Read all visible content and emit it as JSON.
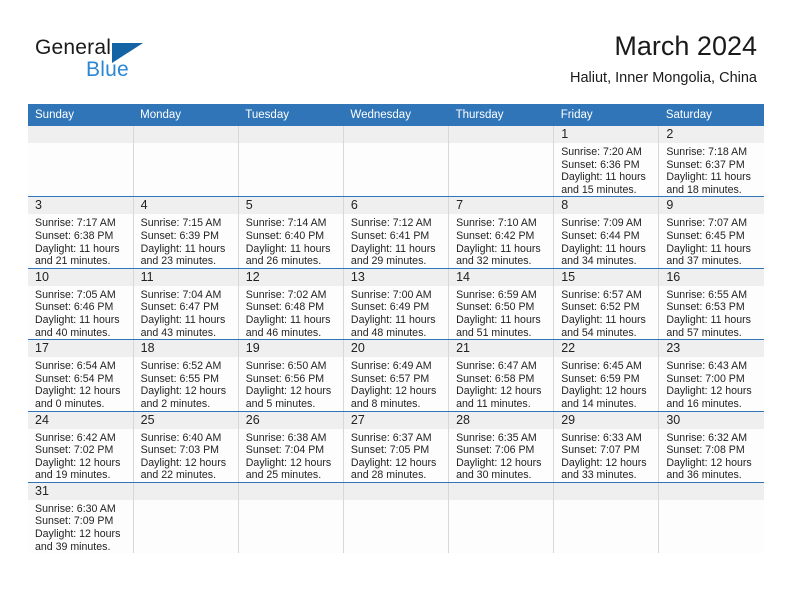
{
  "brand": {
    "name_top": "General",
    "name_bottom": "Blue",
    "triangle_color": "#1464a5",
    "blue_color": "#2b87d3"
  },
  "header": {
    "title": "March 2024",
    "subtitle": "Haliut, Inner Mongolia, China"
  },
  "theme": {
    "header_blue": "#3075b8",
    "day_band_gray": "#efefef",
    "cell_bg": "#fdfdfd",
    "row_divider": "#3075b8",
    "col_divider": "#d8d8d8"
  },
  "weekdays": [
    "Sunday",
    "Monday",
    "Tuesday",
    "Wednesday",
    "Thursday",
    "Friday",
    "Saturday"
  ],
  "weeks": [
    [
      {
        "day": "",
        "lines": []
      },
      {
        "day": "",
        "lines": []
      },
      {
        "day": "",
        "lines": []
      },
      {
        "day": "",
        "lines": []
      },
      {
        "day": "",
        "lines": []
      },
      {
        "day": "1",
        "lines": [
          "Sunrise: 7:20 AM",
          "Sunset: 6:36 PM",
          "Daylight: 11 hours",
          "and 15 minutes."
        ]
      },
      {
        "day": "2",
        "lines": [
          "Sunrise: 7:18 AM",
          "Sunset: 6:37 PM",
          "Daylight: 11 hours",
          "and 18 minutes."
        ]
      }
    ],
    [
      {
        "day": "3",
        "lines": [
          "Sunrise: 7:17 AM",
          "Sunset: 6:38 PM",
          "Daylight: 11 hours",
          "and 21 minutes."
        ]
      },
      {
        "day": "4",
        "lines": [
          "Sunrise: 7:15 AM",
          "Sunset: 6:39 PM",
          "Daylight: 11 hours",
          "and 23 minutes."
        ]
      },
      {
        "day": "5",
        "lines": [
          "Sunrise: 7:14 AM",
          "Sunset: 6:40 PM",
          "Daylight: 11 hours",
          "and 26 minutes."
        ]
      },
      {
        "day": "6",
        "lines": [
          "Sunrise: 7:12 AM",
          "Sunset: 6:41 PM",
          "Daylight: 11 hours",
          "and 29 minutes."
        ]
      },
      {
        "day": "7",
        "lines": [
          "Sunrise: 7:10 AM",
          "Sunset: 6:42 PM",
          "Daylight: 11 hours",
          "and 32 minutes."
        ]
      },
      {
        "day": "8",
        "lines": [
          "Sunrise: 7:09 AM",
          "Sunset: 6:44 PM",
          "Daylight: 11 hours",
          "and 34 minutes."
        ]
      },
      {
        "day": "9",
        "lines": [
          "Sunrise: 7:07 AM",
          "Sunset: 6:45 PM",
          "Daylight: 11 hours",
          "and 37 minutes."
        ]
      }
    ],
    [
      {
        "day": "10",
        "lines": [
          "Sunrise: 7:05 AM",
          "Sunset: 6:46 PM",
          "Daylight: 11 hours",
          "and 40 minutes."
        ]
      },
      {
        "day": "11",
        "lines": [
          "Sunrise: 7:04 AM",
          "Sunset: 6:47 PM",
          "Daylight: 11 hours",
          "and 43 minutes."
        ]
      },
      {
        "day": "12",
        "lines": [
          "Sunrise: 7:02 AM",
          "Sunset: 6:48 PM",
          "Daylight: 11 hours",
          "and 46 minutes."
        ]
      },
      {
        "day": "13",
        "lines": [
          "Sunrise: 7:00 AM",
          "Sunset: 6:49 PM",
          "Daylight: 11 hours",
          "and 48 minutes."
        ]
      },
      {
        "day": "14",
        "lines": [
          "Sunrise: 6:59 AM",
          "Sunset: 6:50 PM",
          "Daylight: 11 hours",
          "and 51 minutes."
        ]
      },
      {
        "day": "15",
        "lines": [
          "Sunrise: 6:57 AM",
          "Sunset: 6:52 PM",
          "Daylight: 11 hours",
          "and 54 minutes."
        ]
      },
      {
        "day": "16",
        "lines": [
          "Sunrise: 6:55 AM",
          "Sunset: 6:53 PM",
          "Daylight: 11 hours",
          "and 57 minutes."
        ]
      }
    ],
    [
      {
        "day": "17",
        "lines": [
          "Sunrise: 6:54 AM",
          "Sunset: 6:54 PM",
          "Daylight: 12 hours",
          "and 0 minutes."
        ]
      },
      {
        "day": "18",
        "lines": [
          "Sunrise: 6:52 AM",
          "Sunset: 6:55 PM",
          "Daylight: 12 hours",
          "and 2 minutes."
        ]
      },
      {
        "day": "19",
        "lines": [
          "Sunrise: 6:50 AM",
          "Sunset: 6:56 PM",
          "Daylight: 12 hours",
          "and 5 minutes."
        ]
      },
      {
        "day": "20",
        "lines": [
          "Sunrise: 6:49 AM",
          "Sunset: 6:57 PM",
          "Daylight: 12 hours",
          "and 8 minutes."
        ]
      },
      {
        "day": "21",
        "lines": [
          "Sunrise: 6:47 AM",
          "Sunset: 6:58 PM",
          "Daylight: 12 hours",
          "and 11 minutes."
        ]
      },
      {
        "day": "22",
        "lines": [
          "Sunrise: 6:45 AM",
          "Sunset: 6:59 PM",
          "Daylight: 12 hours",
          "and 14 minutes."
        ]
      },
      {
        "day": "23",
        "lines": [
          "Sunrise: 6:43 AM",
          "Sunset: 7:00 PM",
          "Daylight: 12 hours",
          "and 16 minutes."
        ]
      }
    ],
    [
      {
        "day": "24",
        "lines": [
          "Sunrise: 6:42 AM",
          "Sunset: 7:02 PM",
          "Daylight: 12 hours",
          "and 19 minutes."
        ]
      },
      {
        "day": "25",
        "lines": [
          "Sunrise: 6:40 AM",
          "Sunset: 7:03 PM",
          "Daylight: 12 hours",
          "and 22 minutes."
        ]
      },
      {
        "day": "26",
        "lines": [
          "Sunrise: 6:38 AM",
          "Sunset: 7:04 PM",
          "Daylight: 12 hours",
          "and 25 minutes."
        ]
      },
      {
        "day": "27",
        "lines": [
          "Sunrise: 6:37 AM",
          "Sunset: 7:05 PM",
          "Daylight: 12 hours",
          "and 28 minutes."
        ]
      },
      {
        "day": "28",
        "lines": [
          "Sunrise: 6:35 AM",
          "Sunset: 7:06 PM",
          "Daylight: 12 hours",
          "and 30 minutes."
        ]
      },
      {
        "day": "29",
        "lines": [
          "Sunrise: 6:33 AM",
          "Sunset: 7:07 PM",
          "Daylight: 12 hours",
          "and 33 minutes."
        ]
      },
      {
        "day": "30",
        "lines": [
          "Sunrise: 6:32 AM",
          "Sunset: 7:08 PM",
          "Daylight: 12 hours",
          "and 36 minutes."
        ]
      }
    ],
    [
      {
        "day": "31",
        "lines": [
          "Sunrise: 6:30 AM",
          "Sunset: 7:09 PM",
          "Daylight: 12 hours",
          "and 39 minutes."
        ]
      },
      {
        "day": "",
        "lines": []
      },
      {
        "day": "",
        "lines": []
      },
      {
        "day": "",
        "lines": []
      },
      {
        "day": "",
        "lines": []
      },
      {
        "day": "",
        "lines": []
      },
      {
        "day": "",
        "lines": []
      }
    ]
  ]
}
